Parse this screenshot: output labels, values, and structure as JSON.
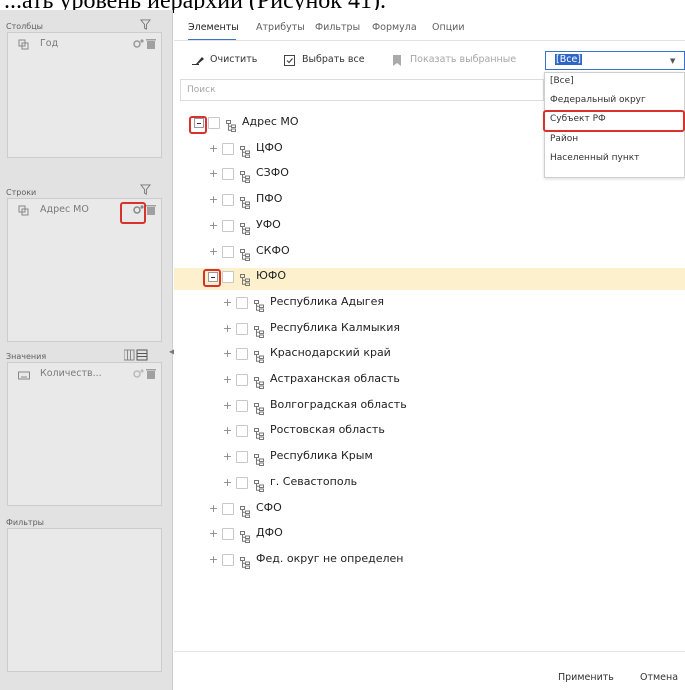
{
  "doc_caption": "...ать уровень иерархии (Рисунок 41).",
  "left": {
    "columns": {
      "title": "Столбцы",
      "item": "Год"
    },
    "rows": {
      "title": "Строки",
      "item": "Адрес МО"
    },
    "values": {
      "title": "Значения",
      "item": "Количеств..."
    },
    "filters": {
      "title": "Фильтры"
    }
  },
  "tabs": [
    "Элементы",
    "Атрибуты",
    "Фильтры",
    "Формула",
    "Опции"
  ],
  "toolbar": {
    "clear": "Очистить",
    "select_all": "Выбрать все",
    "show_selected": "Показать выбранные"
  },
  "level_select": {
    "value": "[Все]",
    "options": [
      "[Все]",
      "Федеральный округ",
      "Субъект РФ",
      "Район",
      "Населенный пункт"
    ]
  },
  "search": {
    "placeholder": "Поиск"
  },
  "tree": [
    {
      "label": "Адрес МО",
      "level": 0,
      "expanded": true
    },
    {
      "label": "ЦФО",
      "level": 1
    },
    {
      "label": "СЗФО",
      "level": 1
    },
    {
      "label": "ПФО",
      "level": 1
    },
    {
      "label": "УФО",
      "level": 1
    },
    {
      "label": "СКФО",
      "level": 1
    },
    {
      "label": "ЮФО",
      "level": 1,
      "expanded": true,
      "highlighted": true
    },
    {
      "label": "Республика Адыгея",
      "level": 2
    },
    {
      "label": "Республика Калмыкия",
      "level": 2
    },
    {
      "label": "Краснодарский край",
      "level": 2
    },
    {
      "label": "Астраханская область",
      "level": 2
    },
    {
      "label": "Волгоградская область",
      "level": 2
    },
    {
      "label": "Ростовская область",
      "level": 2
    },
    {
      "label": "Республика Крым",
      "level": 2
    },
    {
      "label": "г. Севастополь",
      "level": 2
    },
    {
      "label": "СФО",
      "level": 1
    },
    {
      "label": "ДФО",
      "level": 1
    },
    {
      "label": "Фед. округ не определен",
      "level": 1
    }
  ],
  "footer": {
    "apply": "Применить",
    "cancel": "Отмена"
  },
  "colors": {
    "accent": "#3a71c9",
    "highlight_row": "#fdf0cc",
    "annotation_red": "#d9312b",
    "panel_bg": "#e2e2e2"
  }
}
